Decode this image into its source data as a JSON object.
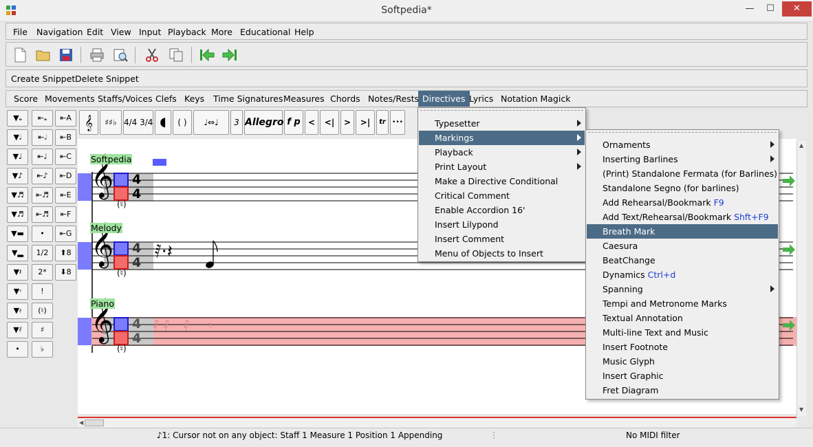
{
  "window": {
    "title": "Softpedia*"
  },
  "menubar": [
    "File",
    "Navigation",
    "Edit",
    "View",
    "Input",
    "Playback",
    "More",
    "Educational",
    "Help"
  ],
  "snippets": {
    "create": "Create Snippet",
    "delete": "Delete Snippet"
  },
  "object_menu": [
    "Score",
    "Movements",
    "Staffs/Voices",
    "Clefs",
    "Keys",
    "Time Signatures",
    "Measures",
    "Chords",
    "Notes/Rests",
    "Directives",
    "Lyrics",
    "Notation Magick"
  ],
  "palette": {
    "col2": [
      "",
      "",
      "",
      "",
      "",
      "",
      "•",
      "1/2",
      "2*",
      "!",
      "(♮)",
      "♯",
      "♭"
    ],
    "col3": [
      "A",
      "B",
      "C",
      "D",
      "E",
      "F",
      "G",
      "8",
      "8"
    ]
  },
  "score_toolbar": {
    "timesig": "4/4 3/4",
    "paren": "( )",
    "triplet": "3",
    "tempo": "Allegro",
    "dyn": "f p",
    "nav1": "<",
    "nav2": "<|",
    "nav3": ">",
    "nav4": ">|",
    "trill": "tr",
    "more": "•••"
  },
  "staffs": [
    {
      "name": "Softpedia"
    },
    {
      "name": "Melody"
    },
    {
      "name": "Piano"
    }
  ],
  "timesig_digit": "4",
  "directives_menu": [
    {
      "label": "Typesetter",
      "submenu": true
    },
    {
      "label": "Markings",
      "submenu": true,
      "selected": true
    },
    {
      "label": "Playback",
      "submenu": true
    },
    {
      "label": "Print Layout",
      "submenu": true
    },
    {
      "label": "Make a Directive Conditional",
      "submenu": false
    },
    {
      "label": "Critical Comment",
      "submenu": false
    },
    {
      "label": "Enable Accordion 16'",
      "submenu": false
    },
    {
      "label": "Insert Lilypond",
      "submenu": false
    },
    {
      "label": "Insert Comment",
      "submenu": false
    },
    {
      "label": "Menu of Objects to Insert",
      "submenu": false
    }
  ],
  "markings_menu": [
    {
      "label": "Ornaments",
      "accel": "",
      "submenu": true
    },
    {
      "label": "Inserting Barlines",
      "accel": "",
      "submenu": true
    },
    {
      "label": "(Print) Standalone Fermata (for Barlines)",
      "accel": "",
      "submenu": false
    },
    {
      "label": "Standalone Segno (for barlines)",
      "accel": "",
      "submenu": false
    },
    {
      "label": "Add Rehearsal/Bookmark",
      "accel": "F9",
      "submenu": false
    },
    {
      "label": "Add Text/Rehearsal/Bookmark",
      "accel": "Shft+F9",
      "submenu": false
    },
    {
      "label": "Breath Mark",
      "accel": "",
      "submenu": false,
      "selected": true
    },
    {
      "label": "Caesura",
      "accel": "",
      "submenu": false
    },
    {
      "label": "BeatChange",
      "accel": "",
      "submenu": false
    },
    {
      "label": "Dynamics",
      "accel": "Ctrl+d",
      "submenu": false
    },
    {
      "label": "Spanning",
      "accel": "",
      "submenu": true
    },
    {
      "label": "Tempi and Metronome Marks",
      "accel": "",
      "submenu": false
    },
    {
      "label": "Textual Annotation",
      "accel": "",
      "submenu": false
    },
    {
      "label": "Multi-line Text and Music",
      "accel": "",
      "submenu": false
    },
    {
      "label": "Insert Footnote",
      "accel": "",
      "submenu": false
    },
    {
      "label": "Music Glyph",
      "accel": "",
      "submenu": false
    },
    {
      "label": "Insert Graphic",
      "accel": "",
      "submenu": false
    },
    {
      "label": "Fret Diagram",
      "accel": "",
      "submenu": false
    }
  ],
  "status": {
    "left": "1: Cursor not on any object:  Staff 1 Measure 1 Position 1 Appending",
    "right": "No MIDI filter"
  },
  "colors": {
    "selected": "#4c6b86",
    "accent_close": "#c7423d",
    "staff_highlight": "#f6b0b0"
  }
}
